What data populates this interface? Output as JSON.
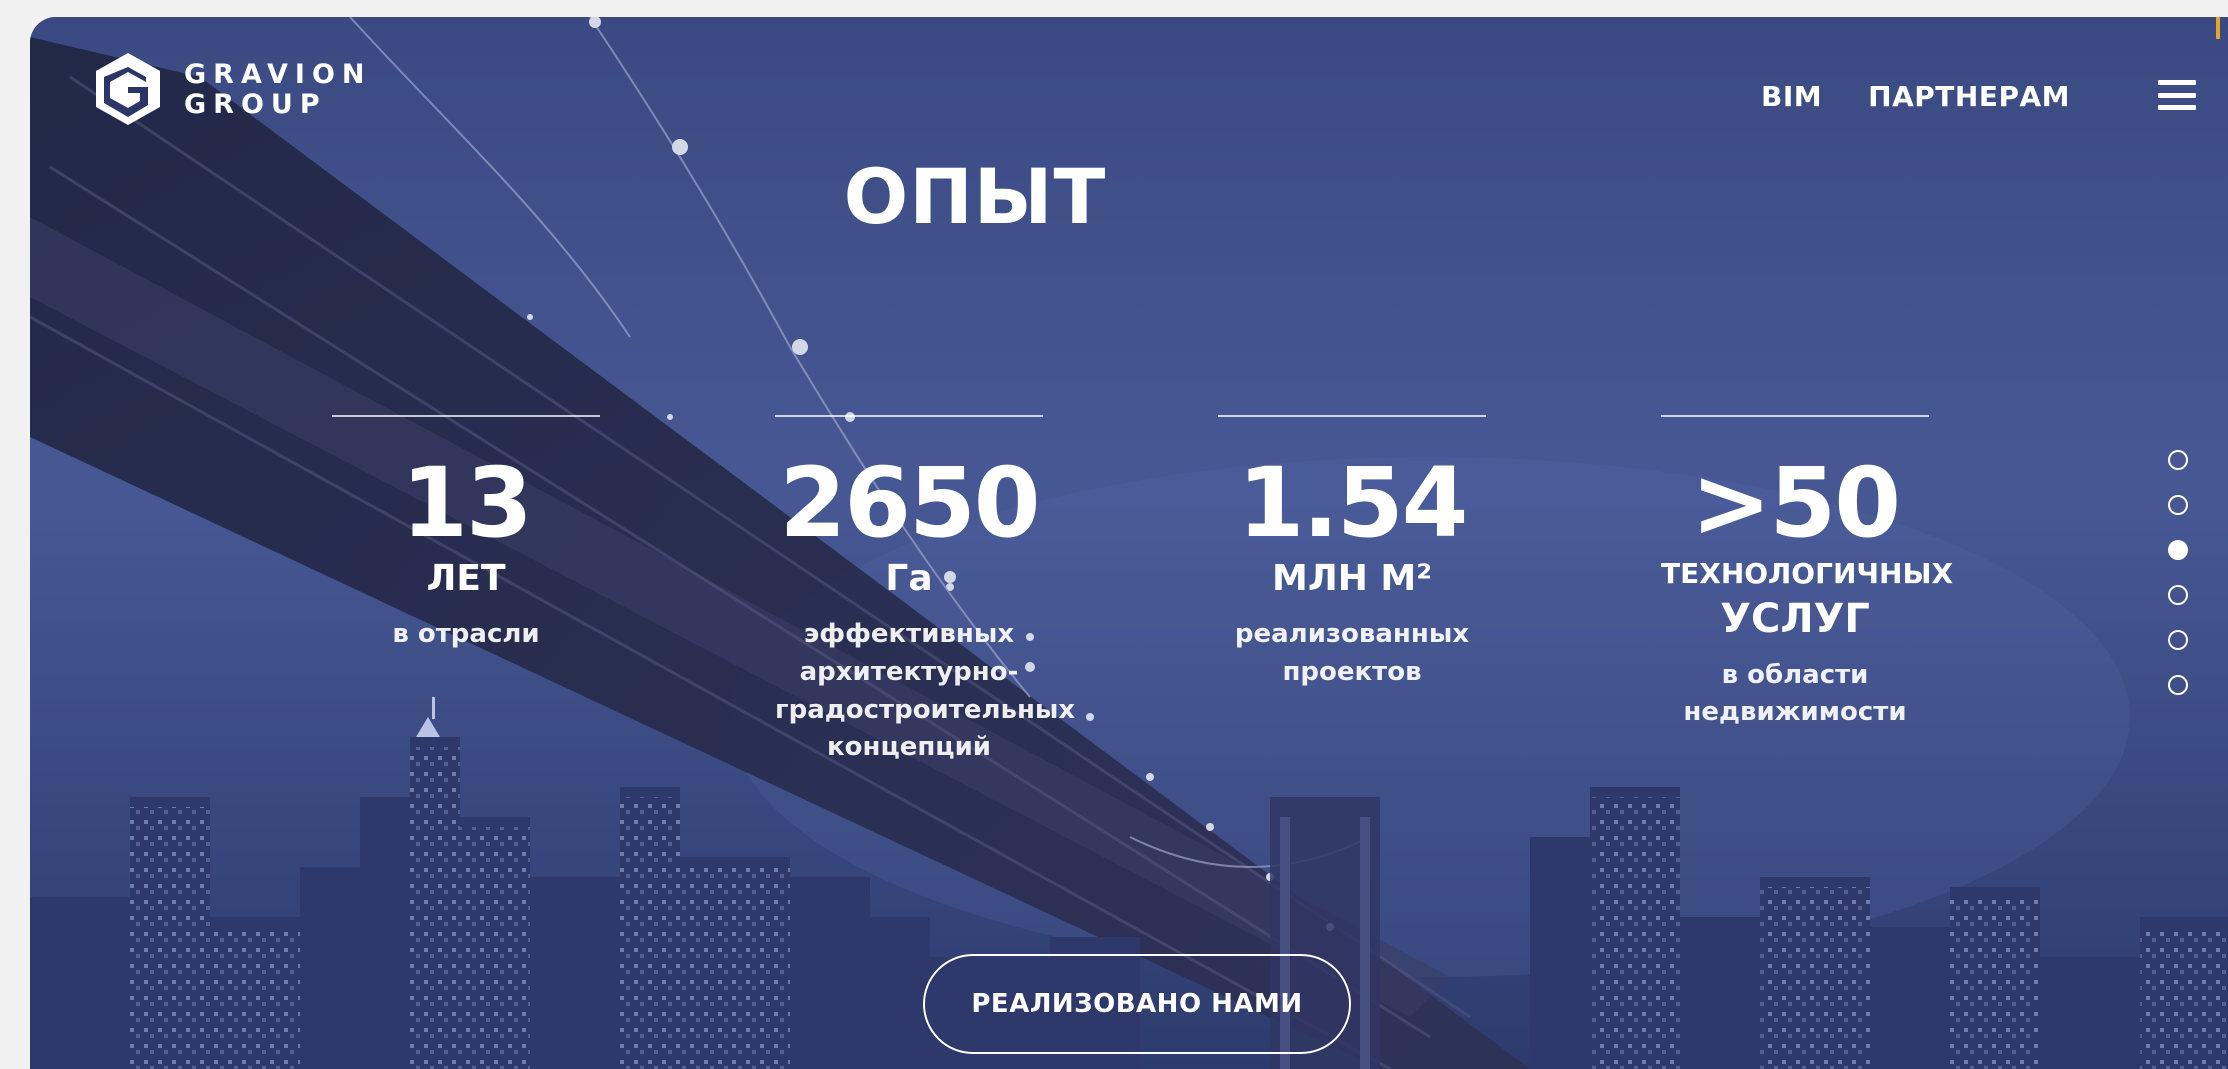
{
  "brand": {
    "line1": "GRAVION",
    "line2": "GROUP"
  },
  "nav": {
    "items": [
      {
        "label": "BIM"
      },
      {
        "label": "ПАРТНЕРАМ"
      }
    ]
  },
  "page": {
    "title": "ОПЫТ"
  },
  "stats": [
    {
      "number": "13",
      "unit": "ЛЕТ",
      "desc": [
        "в отрасли"
      ]
    },
    {
      "number": "2650",
      "unit": "Га",
      "desc": [
        "эффективных",
        "архитектурно-",
        "градостроительных",
        "концепций"
      ]
    },
    {
      "number": "1.54",
      "unit": "МЛН М²",
      "desc": [
        "реализованных",
        "проектов"
      ]
    },
    {
      "number": ">50",
      "unit": "ТЕХНОЛОГИЧНЫХ",
      "unit2": "УСЛУГ",
      "desc": [
        "в области",
        "недвижимости"
      ]
    }
  ],
  "slides": {
    "count": 6,
    "active_index": 2
  },
  "cta": {
    "label": "РЕАЛИЗОВАНО НАМИ"
  },
  "colors": {
    "sky_top": "#4a5b94",
    "sky_bottom": "#2a3562",
    "text": "#ffffff",
    "accent": "#e3a42a"
  }
}
